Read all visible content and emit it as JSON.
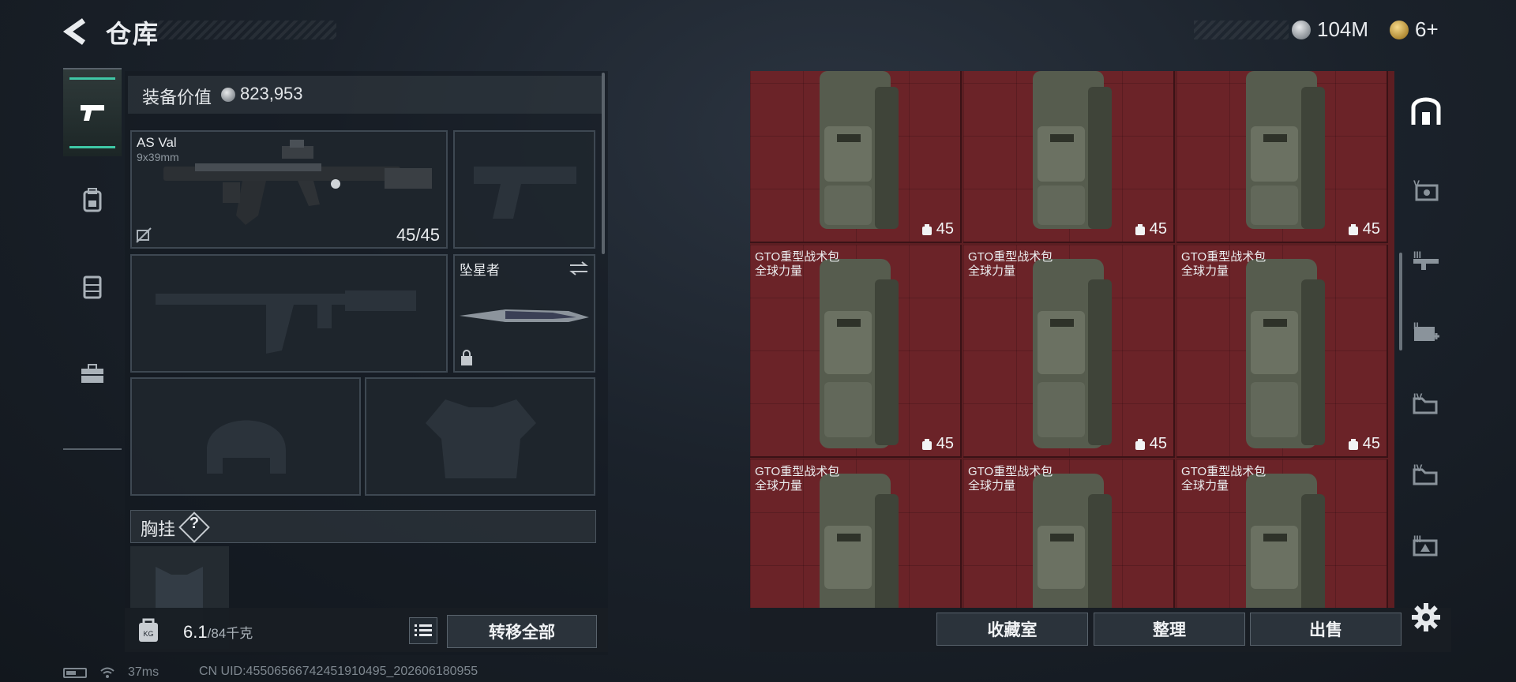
{
  "header": {
    "title": "仓库",
    "currency_silver": "104M",
    "currency_gold": "6+"
  },
  "loadout": {
    "equip_value_label": "装备价值",
    "equip_value_amount": "823,953",
    "primary": {
      "name": "AS Val",
      "caliber": "9x39mm",
      "ammo": "45/45"
    },
    "melee": {
      "name": "坠星者"
    },
    "chest_rig_label": "胸挂",
    "chest_rig_help": "?",
    "weight_value": "6.1",
    "weight_cap": "/84千克",
    "transfer_all_label": "转移全部"
  },
  "storage": {
    "items": [
      {
        "name": "",
        "brand": "",
        "qty": "45"
      },
      {
        "name": "",
        "brand": "",
        "qty": "45"
      },
      {
        "name": "",
        "brand": "",
        "qty": "45"
      },
      {
        "name": "GTO重型战术包",
        "brand": "全球力量",
        "qty": "45"
      },
      {
        "name": "GTO重型战术包",
        "brand": "全球力量",
        "qty": "45"
      },
      {
        "name": "GTO重型战术包",
        "brand": "全球力量",
        "qty": "45"
      },
      {
        "name": "GTO重型战术包",
        "brand": "全球力量",
        "qty": ""
      },
      {
        "name": "GTO重型战术包",
        "brand": "全球力量",
        "qty": ""
      },
      {
        "name": "GTO重型战术包",
        "brand": "全球力量",
        "qty": ""
      }
    ],
    "collection_room_label": "收藏室",
    "organize_label": "整理",
    "sell_label": "出售"
  },
  "filters": {
    "levels": [
      "V",
      "III",
      "II",
      "IV",
      "IV",
      "III"
    ]
  },
  "status": {
    "ping": "37ms",
    "uid": "CN UID:455065667424519104​95_202606180955"
  },
  "colors": {
    "accent": "#3fc8a6",
    "storage_bg": "#6b2328"
  }
}
